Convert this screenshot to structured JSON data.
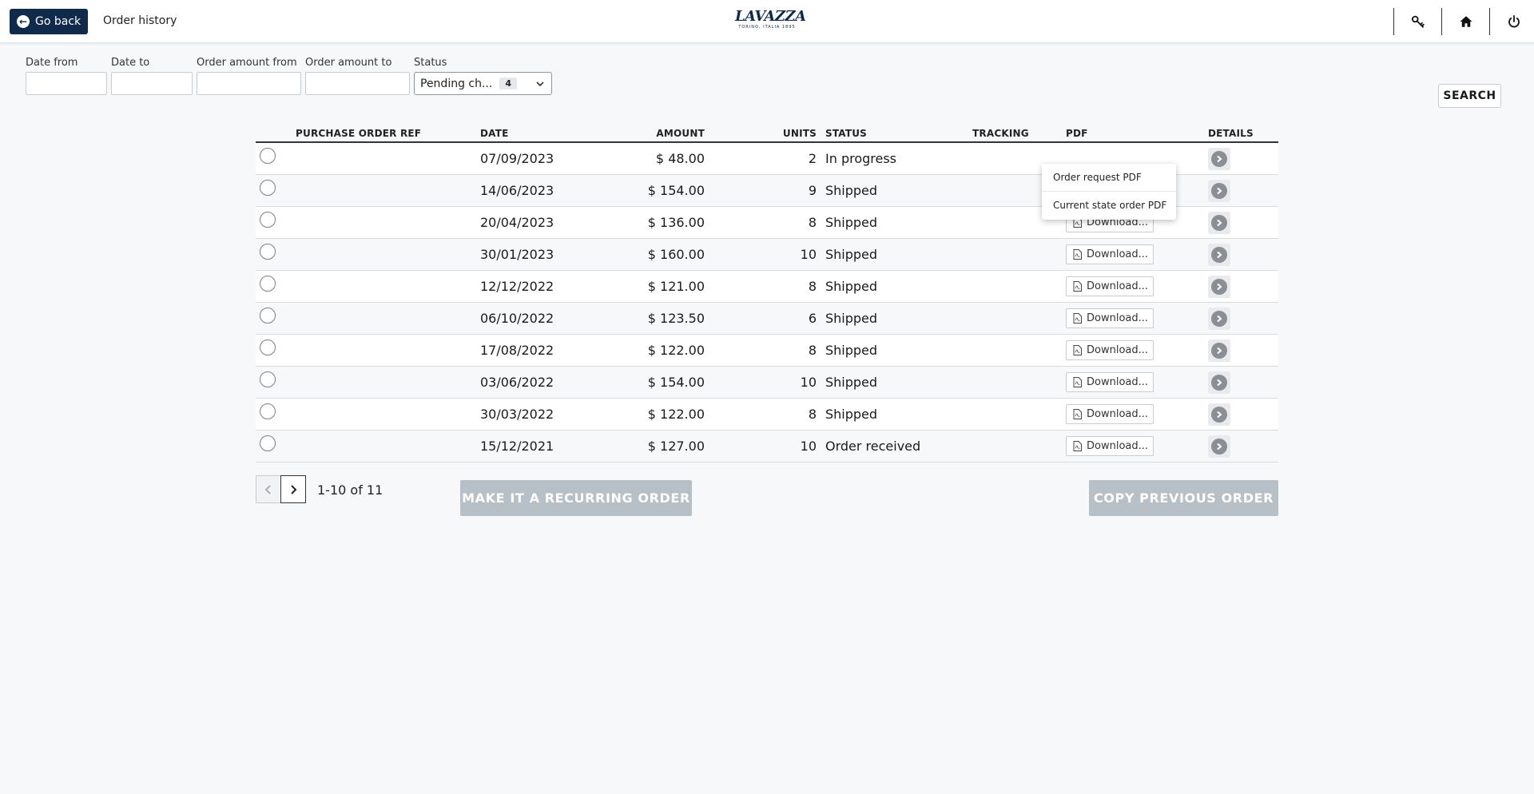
{
  "header": {
    "go_back_label": "Go back",
    "breadcrumb": "Order history",
    "logo_text": "LAVAZZA",
    "logo_tagline": "TORINO, ITALIA 1895",
    "icons": [
      "key-icon",
      "home-icon",
      "power-icon"
    ]
  },
  "filters": {
    "date_from_label": "Date from",
    "date_to_label": "Date to",
    "amount_from_label": "Order amount from",
    "amount_to_label": "Order amount to",
    "status_label": "Status",
    "status_value": "Pending ch...",
    "status_count": "4",
    "search_label": "SEARCH"
  },
  "table": {
    "headers": {
      "ref": "PURCHASE ORDER REF",
      "date": "DATE",
      "amount": "AMOUNT",
      "units": "UNITS",
      "status": "STATUS",
      "tracking": "TRACKING",
      "pdf": "PDF",
      "details": "DETAILS"
    },
    "download_label": "Download...",
    "rows": [
      {
        "ref": "",
        "date": "07/09/2023",
        "amount": "$ 48.00",
        "units": "2",
        "status": "In progress",
        "tracking": ""
      },
      {
        "ref": "",
        "date": "14/06/2023",
        "amount": "$ 154.00",
        "units": "9",
        "status": "Shipped",
        "tracking": ""
      },
      {
        "ref": "",
        "date": "20/04/2023",
        "amount": "$ 136.00",
        "units": "8",
        "status": "Shipped",
        "tracking": ""
      },
      {
        "ref": "",
        "date": "30/01/2023",
        "amount": "$ 160.00",
        "units": "10",
        "status": "Shipped",
        "tracking": ""
      },
      {
        "ref": "",
        "date": "12/12/2022",
        "amount": "$ 121.00",
        "units": "8",
        "status": "Shipped",
        "tracking": ""
      },
      {
        "ref": "",
        "date": "06/10/2022",
        "amount": "$ 123.50",
        "units": "6",
        "status": "Shipped",
        "tracking": ""
      },
      {
        "ref": "",
        "date": "17/08/2022",
        "amount": "$ 122.00",
        "units": "8",
        "status": "Shipped",
        "tracking": ""
      },
      {
        "ref": "",
        "date": "03/06/2022",
        "amount": "$ 154.00",
        "units": "10",
        "status": "Shipped",
        "tracking": ""
      },
      {
        "ref": "",
        "date": "30/03/2022",
        "amount": "$ 122.00",
        "units": "8",
        "status": "Shipped",
        "tracking": ""
      },
      {
        "ref": "",
        "date": "15/12/2021",
        "amount": "$ 127.00",
        "units": "10",
        "status": "Order received",
        "tracking": ""
      }
    ]
  },
  "pdf_menu": {
    "item_1": "Order request PDF",
    "item_2": "Current state order PDF"
  },
  "pagination": {
    "range_text": "1-10 of 11"
  },
  "actions": {
    "recurring_label": "MAKE IT A RECURRING ORDER",
    "copy_label": "COPY PREVIOUS ORDER"
  }
}
